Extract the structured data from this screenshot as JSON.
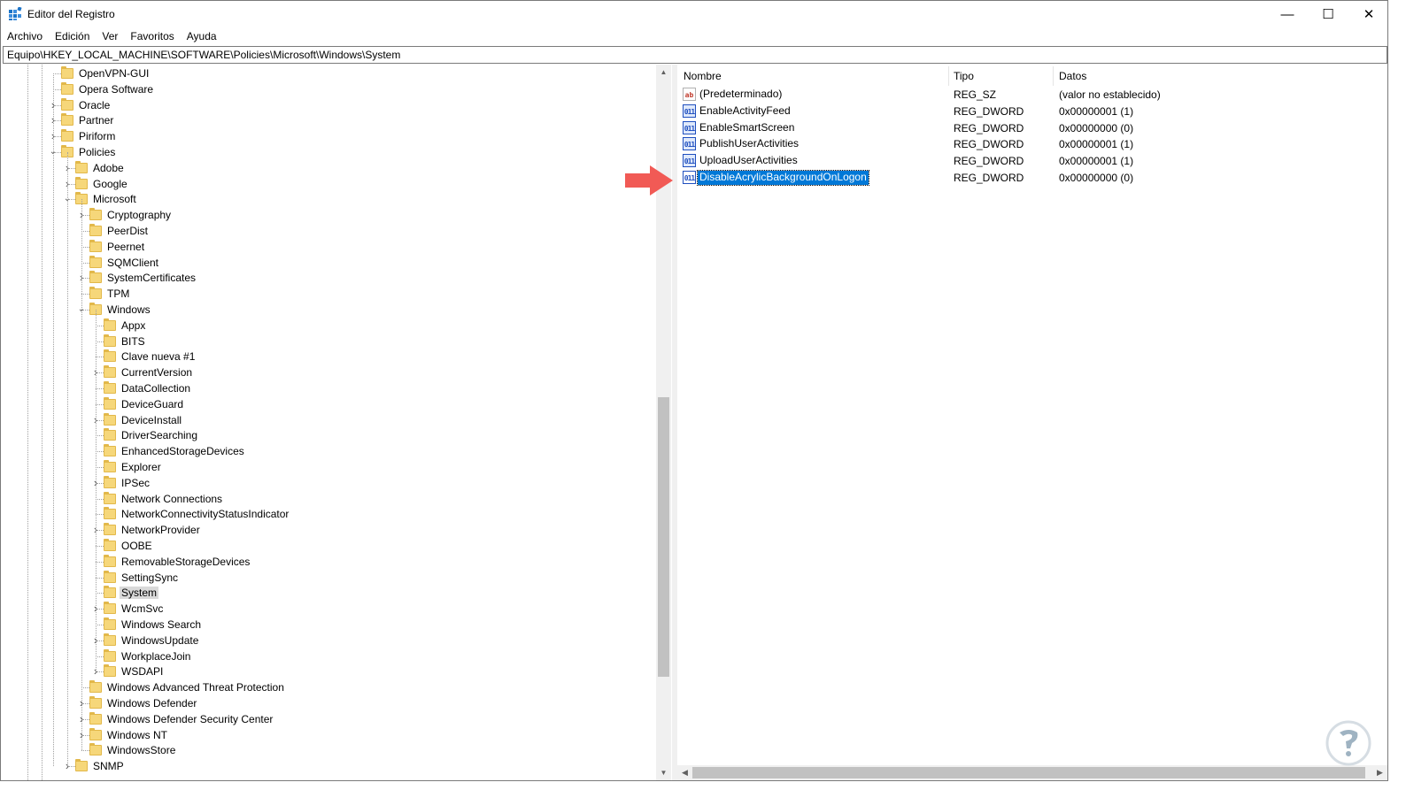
{
  "window": {
    "title": "Editor del Registro",
    "controls": {
      "minimize": "—",
      "maximize": "☐",
      "close": "✕"
    }
  },
  "menu": [
    "Archivo",
    "Edición",
    "Ver",
    "Favoritos",
    "Ayuda"
  ],
  "address": "Equipo\\HKEY_LOCAL_MACHINE\\SOFTWARE\\Policies\\Microsoft\\Windows\\System",
  "tree": {
    "items": [
      {
        "label": "OpenVPN-GUI",
        "level": 0,
        "chevron": ""
      },
      {
        "label": "Opera Software",
        "level": 0,
        "chevron": ""
      },
      {
        "label": "Oracle",
        "level": 0,
        "chevron": "collapsed"
      },
      {
        "label": "Partner",
        "level": 0,
        "chevron": "collapsed"
      },
      {
        "label": "Piriform",
        "level": 0,
        "chevron": "collapsed"
      },
      {
        "label": "Policies",
        "level": 0,
        "chevron": "expanded"
      },
      {
        "label": "Adobe",
        "level": 1,
        "chevron": "collapsed"
      },
      {
        "label": "Google",
        "level": 1,
        "chevron": "collapsed"
      },
      {
        "label": "Microsoft",
        "level": 1,
        "chevron": "expanded"
      },
      {
        "label": "Cryptography",
        "level": 2,
        "chevron": "collapsed"
      },
      {
        "label": "PeerDist",
        "level": 2,
        "chevron": ""
      },
      {
        "label": "Peernet",
        "level": 2,
        "chevron": ""
      },
      {
        "label": "SQMClient",
        "level": 2,
        "chevron": ""
      },
      {
        "label": "SystemCertificates",
        "level": 2,
        "chevron": "collapsed"
      },
      {
        "label": "TPM",
        "level": 2,
        "chevron": ""
      },
      {
        "label": "Windows",
        "level": 2,
        "chevron": "expanded"
      },
      {
        "label": "Appx",
        "level": 3,
        "chevron": ""
      },
      {
        "label": "BITS",
        "level": 3,
        "chevron": ""
      },
      {
        "label": "Clave nueva #1",
        "level": 3,
        "chevron": ""
      },
      {
        "label": "CurrentVersion",
        "level": 3,
        "chevron": "collapsed"
      },
      {
        "label": "DataCollection",
        "level": 3,
        "chevron": ""
      },
      {
        "label": "DeviceGuard",
        "level": 3,
        "chevron": ""
      },
      {
        "label": "DeviceInstall",
        "level": 3,
        "chevron": "collapsed"
      },
      {
        "label": "DriverSearching",
        "level": 3,
        "chevron": ""
      },
      {
        "label": "EnhancedStorageDevices",
        "level": 3,
        "chevron": ""
      },
      {
        "label": "Explorer",
        "level": 3,
        "chevron": ""
      },
      {
        "label": "IPSec",
        "level": 3,
        "chevron": "collapsed"
      },
      {
        "label": "Network Connections",
        "level": 3,
        "chevron": ""
      },
      {
        "label": "NetworkConnectivityStatusIndicator",
        "level": 3,
        "chevron": ""
      },
      {
        "label": "NetworkProvider",
        "level": 3,
        "chevron": "collapsed"
      },
      {
        "label": "OOBE",
        "level": 3,
        "chevron": ""
      },
      {
        "label": "RemovableStorageDevices",
        "level": 3,
        "chevron": ""
      },
      {
        "label": "SettingSync",
        "level": 3,
        "chevron": ""
      },
      {
        "label": "System",
        "level": 3,
        "chevron": "",
        "selected": true
      },
      {
        "label": "WcmSvc",
        "level": 3,
        "chevron": "collapsed"
      },
      {
        "label": "Windows Search",
        "level": 3,
        "chevron": ""
      },
      {
        "label": "WindowsUpdate",
        "level": 3,
        "chevron": "collapsed"
      },
      {
        "label": "WorkplaceJoin",
        "level": 3,
        "chevron": ""
      },
      {
        "label": "WSDAPI",
        "level": 3,
        "chevron": "collapsed"
      },
      {
        "label": "Windows Advanced Threat Protection",
        "level": 2,
        "chevron": ""
      },
      {
        "label": "Windows Defender",
        "level": 2,
        "chevron": "collapsed"
      },
      {
        "label": "Windows Defender Security Center",
        "level": 2,
        "chevron": "collapsed"
      },
      {
        "label": "Windows NT",
        "level": 2,
        "chevron": "collapsed"
      },
      {
        "label": "WindowsStore",
        "level": 2,
        "chevron": ""
      },
      {
        "label": "SNMP",
        "level": 1,
        "chevron": "collapsed"
      }
    ]
  },
  "list": {
    "columns": [
      "Nombre",
      "Tipo",
      "Datos"
    ],
    "rows": [
      {
        "name": "(Predeterminado)",
        "type": "REG_SZ",
        "data": "(valor no establecido)",
        "icon": "string-value-icon",
        "glyph": "ab"
      },
      {
        "name": "EnableActivityFeed",
        "type": "REG_DWORD",
        "data": "0x00000001 (1)",
        "icon": "binary-value-icon",
        "glyph": "011"
      },
      {
        "name": "EnableSmartScreen",
        "type": "REG_DWORD",
        "data": "0x00000000 (0)",
        "icon": "binary-value-icon",
        "glyph": "011"
      },
      {
        "name": "PublishUserActivities",
        "type": "REG_DWORD",
        "data": "0x00000001 (1)",
        "icon": "binary-value-icon",
        "glyph": "011"
      },
      {
        "name": "UploadUserActivities",
        "type": "REG_DWORD",
        "data": "0x00000001 (1)",
        "icon": "binary-value-icon",
        "glyph": "011"
      },
      {
        "name": "DisableAcrylicBackgroundOnLogon",
        "type": "REG_DWORD",
        "data": "0x00000000 (0)",
        "icon": "binary-value-icon",
        "glyph": "011",
        "selected": true
      }
    ]
  },
  "colors": {
    "selection": "#0078d7",
    "folder": "#f6d77a",
    "arrow": "#f15a55"
  }
}
